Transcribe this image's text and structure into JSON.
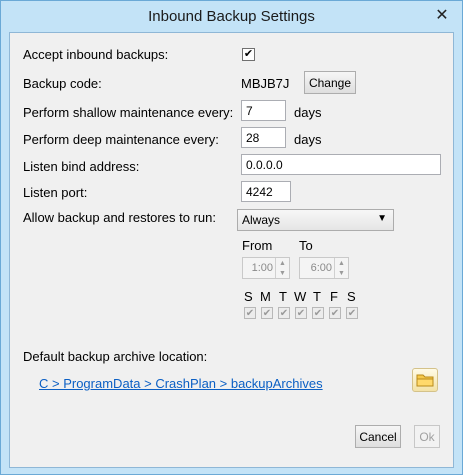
{
  "window": {
    "title": "Inbound Backup Settings",
    "close_glyph": "✕"
  },
  "accept": {
    "label": "Accept inbound backups:",
    "checked": true
  },
  "backup_code": {
    "label": "Backup code:",
    "value": "MBJB7J",
    "change_label": "Change"
  },
  "shallow": {
    "label": "Perform shallow maintenance every:",
    "value": "7",
    "unit": "days"
  },
  "deep": {
    "label": "Perform deep maintenance every:",
    "value": "28",
    "unit": "days"
  },
  "bind": {
    "label": "Listen bind address:",
    "value": "0.0.0.0"
  },
  "port": {
    "label": "Listen port:",
    "value": "4242"
  },
  "run": {
    "label": "Allow backup and restores to run:",
    "selected": "Always"
  },
  "schedule": {
    "from_label": "From",
    "to_label": "To",
    "from_value": "1:00",
    "to_value": "6:00",
    "days": [
      "S",
      "M",
      "T",
      "W",
      "T",
      "F",
      "S"
    ],
    "days_checked": [
      true,
      true,
      true,
      true,
      true,
      true,
      true
    ]
  },
  "archive": {
    "label": "Default backup archive location:",
    "path": "C > ProgramData > CrashPlan > backupArchives"
  },
  "footer": {
    "cancel": "Cancel",
    "ok": "Ok"
  },
  "icons": {
    "close": "close-icon",
    "dropdown": "chevron-down-icon",
    "folder": "folder-icon"
  }
}
